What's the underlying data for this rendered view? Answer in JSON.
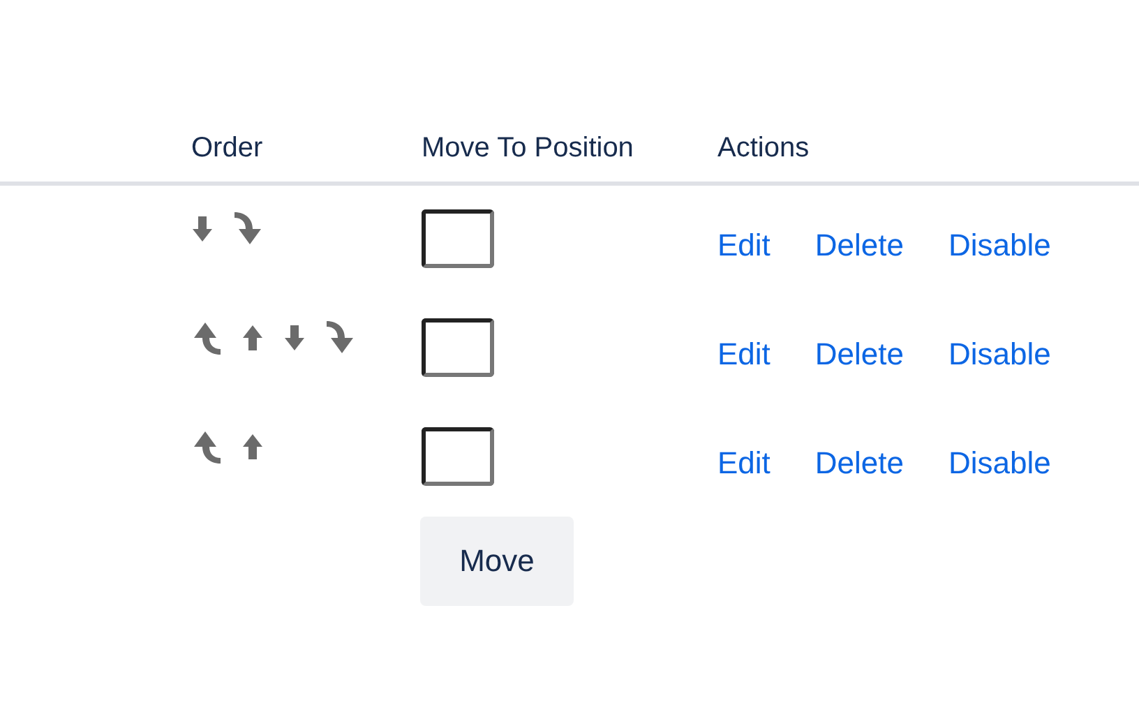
{
  "columns": [
    "Order",
    "Move To Position",
    "Actions"
  ],
  "rows": [
    {
      "order_controls": [
        {
          "kind": "down"
        },
        {
          "kind": "bottom"
        }
      ],
      "actions": [
        "Edit",
        "Delete",
        "Disable"
      ]
    },
    {
      "order_controls": [
        {
          "kind": "top"
        },
        {
          "kind": "up"
        },
        {
          "kind": "down"
        },
        {
          "kind": "bottom"
        }
      ],
      "actions": [
        "Edit",
        "Delete",
        "Disable"
      ]
    },
    {
      "order_controls": [
        {
          "kind": "top"
        },
        {
          "kind": "up"
        }
      ],
      "actions": [
        "Edit",
        "Delete",
        "Disable"
      ]
    }
  ],
  "move_button": "Move"
}
